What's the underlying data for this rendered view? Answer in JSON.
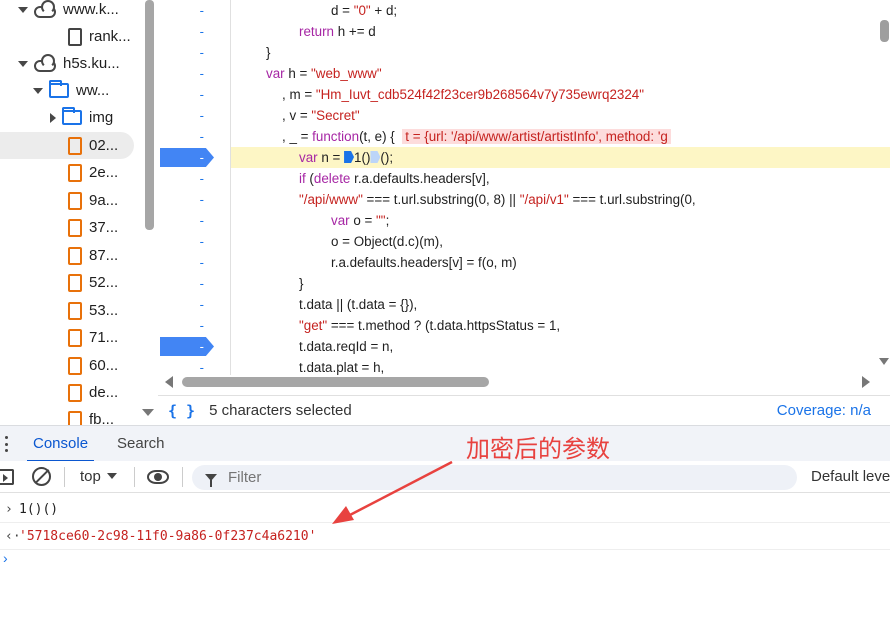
{
  "file_tree": {
    "items": [
      {
        "label": "www.k...",
        "type": "domain",
        "expanded": true
      },
      {
        "label": "rank...",
        "type": "file"
      },
      {
        "label": "h5s.ku...",
        "type": "domain",
        "expanded": true
      },
      {
        "label": "ww...",
        "type": "folder",
        "expanded": true
      },
      {
        "label": "img",
        "type": "folder",
        "expanded": false
      },
      {
        "label": "02...",
        "type": "file",
        "selected": true
      },
      {
        "label": "2e...",
        "type": "file"
      },
      {
        "label": "9a...",
        "type": "file"
      },
      {
        "label": "37...",
        "type": "file"
      },
      {
        "label": "87...",
        "type": "file"
      },
      {
        "label": "52...",
        "type": "file"
      },
      {
        "label": "53...",
        "type": "file"
      },
      {
        "label": "71...",
        "type": "file"
      },
      {
        "label": "60...",
        "type": "file"
      },
      {
        "label": "de...",
        "type": "file"
      },
      {
        "label": "fb...",
        "type": "file"
      }
    ]
  },
  "editor": {
    "gutter_marker": "-",
    "breakpoint_lines": [
      7,
      16
    ],
    "paused_line": 7,
    "lines": {
      "l0_a": "d = ",
      "l0_b": "\"0\"",
      "l0_c": " + d;",
      "l1_kw": "return",
      "l1_rest": " h += d",
      "l2": "}",
      "l3_kw": "var",
      "l3_a": " h = ",
      "l3_str": "\"web_www\"",
      "l4_a": ", m = ",
      "l4_str": "\"Hm_Iuvt_cdb524f42f23cer9b268564v7y735ewrq2324\"",
      "l5_a": ", v = ",
      "l5_str": "\"Secret\"",
      "l6_a": ", _ = ",
      "l6_kw": "function",
      "l6_b": "(t, e) {",
      "l6_inline": "t = {url: '/api/www/artist/artistInfo', method: 'g",
      "l7_kw": "var",
      "l7_a": " n = ",
      "l7_b": "1",
      "l7_c": "()",
      "l7_d": "();",
      "l8_kw": "if",
      "l8_a": " (",
      "l8_kw2": "delete",
      "l8_b": " r.a.defaults.headers[v],",
      "l9_str1": "\"/api/www\"",
      "l9_a": " === t.url.substring(0, 8) || ",
      "l9_str2": "\"/api/v1\"",
      "l9_b": " === t.url.substring(0,",
      "l10_kw": "var",
      "l10_a": " o = ",
      "l10_str": "\"\"",
      "l10_b": ";",
      "l11": "o = Object(d.c)(m),",
      "l12": "r.a.defaults.headers[v] = f(o, m)",
      "l13": "}",
      "l14": "t.data || (t.data = {}),",
      "l15_str": "\"get\"",
      "l15_a": " === t.method ? (t.data.httpsStatus = 1,",
      "l16": "t.data.reqId = n,",
      "l17": "t.data.plat = h,"
    }
  },
  "status_bar": {
    "braces": "{ }",
    "selection": "5 characters selected",
    "coverage": "Coverage: n/a"
  },
  "drawer": {
    "tabs": [
      "Console",
      "Search"
    ],
    "active_tab": "Console"
  },
  "console_toolbar": {
    "context": "top",
    "filter_placeholder": "Filter",
    "levels": "Default levels"
  },
  "console": {
    "input": "1()()",
    "result": "'5718ce60-2c98-11f0-9a86-0f237c4a6210'"
  },
  "annotation": {
    "text": "加密后的参数",
    "color": "#e8423f"
  }
}
